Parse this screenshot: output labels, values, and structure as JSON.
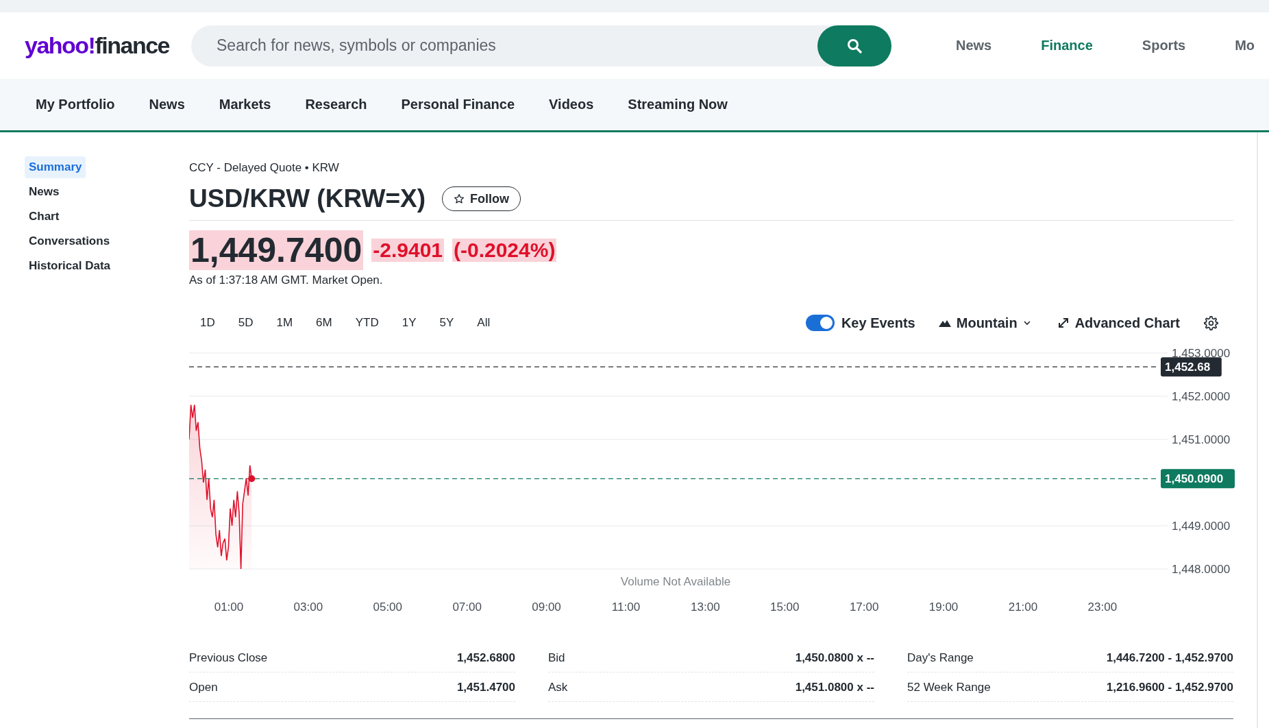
{
  "header": {
    "logo": {
      "brand": "yahoo!",
      "product": "finance"
    },
    "search": {
      "placeholder": "Search for news, symbols or companies"
    },
    "links": [
      {
        "label": "News",
        "selected": false
      },
      {
        "label": "Finance",
        "selected": true
      },
      {
        "label": "Sports",
        "selected": false
      },
      {
        "label": "Mo",
        "selected": false
      }
    ]
  },
  "nav": [
    "My Portfolio",
    "News",
    "Markets",
    "Research",
    "Personal Finance",
    "Videos",
    "Streaming Now"
  ],
  "sidebar": {
    "items": [
      {
        "label": "Summary",
        "selected": true
      },
      {
        "label": "News",
        "selected": false
      },
      {
        "label": "Chart",
        "selected": false
      },
      {
        "label": "Conversations",
        "selected": false
      },
      {
        "label": "Historical Data",
        "selected": false
      }
    ]
  },
  "quote": {
    "source": "CCY - Delayed Quote • KRW",
    "title": "USD/KRW (KRW=X)",
    "follow": "Follow",
    "price": "1,449.7400",
    "change": "-2.9401",
    "change_percent": "(-0.2024%)",
    "as_of": "As of 1:37:18 AM GMT. Market Open."
  },
  "chart_controls": {
    "ranges": [
      {
        "label": "1D",
        "selected": false
      },
      {
        "label": "5D",
        "selected": false
      },
      {
        "label": "1M",
        "selected": false
      },
      {
        "label": "6M",
        "selected": false
      },
      {
        "label": "YTD",
        "selected": false
      },
      {
        "label": "1Y",
        "selected": false
      },
      {
        "label": "5Y",
        "selected": false
      },
      {
        "label": "All",
        "selected": false
      }
    ],
    "key_events": {
      "label": "Key Events",
      "on": true
    },
    "chart_type": "Mountain",
    "advanced": "Advanced Chart"
  },
  "chart": {
    "volume_note": "Volume Not Available",
    "chart_data": {
      "type": "area",
      "xlim": [
        0,
        24.4
      ],
      "ylim": [
        1448,
        1453
      ],
      "x": [
        0,
        0.045,
        0.09,
        0.135,
        0.18,
        0.225,
        0.27,
        0.315,
        0.36,
        0.405,
        0.45,
        0.495,
        0.54,
        0.585,
        0.63,
        0.675,
        0.72,
        0.765,
        0.81,
        0.855,
        0.9,
        0.945,
        0.99,
        1.035,
        1.08,
        1.125,
        1.17,
        1.215,
        1.26,
        1.305,
        1.35,
        1.395,
        1.44,
        1.485,
        1.53,
        1.575
      ],
      "grid": true,
      "series": [
        {
          "color": "#e0102a",
          "values": [
            1451.0,
            1451.8,
            1451.5,
            1451.8,
            1451.2,
            1451.4,
            1450.8,
            1450.5,
            1450.0,
            1450.3,
            1449.6,
            1450.1,
            1449.4,
            1449.2,
            1449.6,
            1448.8,
            1448.5,
            1448.9,
            1448.3,
            1448.6,
            1448.7,
            1448.2,
            1448.5,
            1449.4,
            1449.0,
            1449.6,
            1449.2,
            1449.8,
            1449.3,
            1448.0,
            1449.5,
            1449.8,
            1450.1,
            1449.7,
            1450.4,
            1450.09
          ]
        }
      ],
      "xticks": [
        {
          "value": 1,
          "label": "01:00"
        },
        {
          "value": 3,
          "label": "03:00"
        },
        {
          "value": 5,
          "label": "05:00"
        },
        {
          "value": 7,
          "label": "07:00"
        },
        {
          "value": 9,
          "label": "09:00"
        },
        {
          "value": 11,
          "label": "11:00"
        },
        {
          "value": 13,
          "label": "13:00"
        },
        {
          "value": 15,
          "label": "15:00"
        },
        {
          "value": 17,
          "label": "17:00"
        },
        {
          "value": 19,
          "label": "19:00"
        },
        {
          "value": 21,
          "label": "21:00"
        },
        {
          "value": 23,
          "label": "23:00"
        }
      ],
      "yticks": [
        {
          "value": 1448,
          "label": "1,448.0000"
        },
        {
          "value": 1449,
          "label": "1,449.0000"
        },
        {
          "value": 1451,
          "label": "1,451.0000"
        },
        {
          "value": 1452,
          "label": "1,452.0000"
        },
        {
          "value": 1453,
          "label": "1,453.0000"
        }
      ],
      "ref_lines": [
        {
          "axis": "y",
          "value": 1452.68,
          "label": "1,452.68",
          "color": "#232a31"
        },
        {
          "axis": "y",
          "value": 1450.09,
          "label": "1,450.0900",
          "color": "#0e7a5f"
        }
      ]
    }
  },
  "stats": [
    [
      {
        "label": "Previous Close",
        "value": "1,452.6800"
      },
      {
        "label": "Open",
        "value": "1,451.4700"
      }
    ],
    [
      {
        "label": "Bid",
        "value": "1,450.0800 x --"
      },
      {
        "label": "Ask",
        "value": "1,451.0800 x --"
      }
    ],
    [
      {
        "label": "Day's Range",
        "value": "1,446.7200 - 1,452.9700"
      },
      {
        "label": "52 Week Range",
        "value": "1,216.9600 - 1,452.9700"
      }
    ]
  ]
}
